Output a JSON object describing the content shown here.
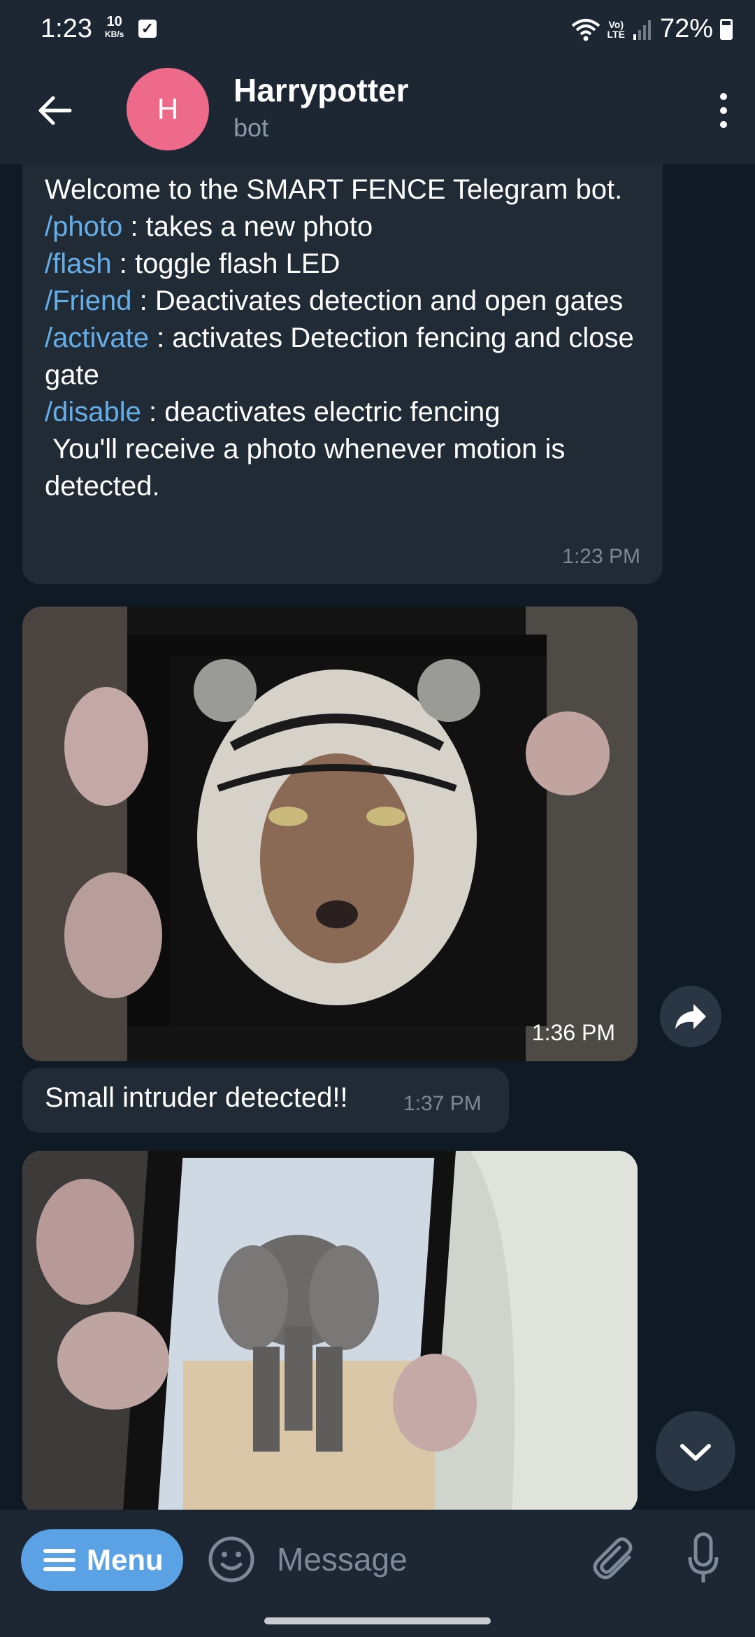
{
  "status_bar": {
    "time": "1:23",
    "speed_value": "10",
    "speed_unit": "KB/s",
    "network_label_top": "Vo)",
    "network_label_bottom": "LTE",
    "battery": "72%",
    "battery_level": 0.72
  },
  "header": {
    "avatar_initial": "H",
    "avatar_color": "#ed6a8a",
    "title": "Harrypotter",
    "subtitle": "bot"
  },
  "messages": {
    "welcome": {
      "line1": "Welcome to the SMART FENCE Telegram bot.",
      "commands": [
        {
          "cmd": "/photo",
          "desc": " : takes a new photo"
        },
        {
          "cmd": "/flash",
          "desc": " : toggle flash LED"
        },
        {
          "cmd": "/Friend",
          "desc": " : Deactivates detection and open gates"
        },
        {
          "cmd": "/activate",
          "desc": " : activates Detection fencing and close gate"
        },
        {
          "cmd": "/disable",
          "desc": " : deactivates electric fencing"
        }
      ],
      "footer": " You'll receive a photo whenever motion is detected.",
      "time": "1:23 PM"
    },
    "photo1": {
      "time": "1:36 PM"
    },
    "intruder": {
      "text": "Small intruder detected!!",
      "time": "1:37 PM"
    }
  },
  "input_bar": {
    "menu_label": "Menu",
    "placeholder": "Message"
  },
  "colors": {
    "accent": "#5aa2e4",
    "command_link": "#66aee8",
    "bubble": "#202b36",
    "background": "#0f1a24"
  }
}
